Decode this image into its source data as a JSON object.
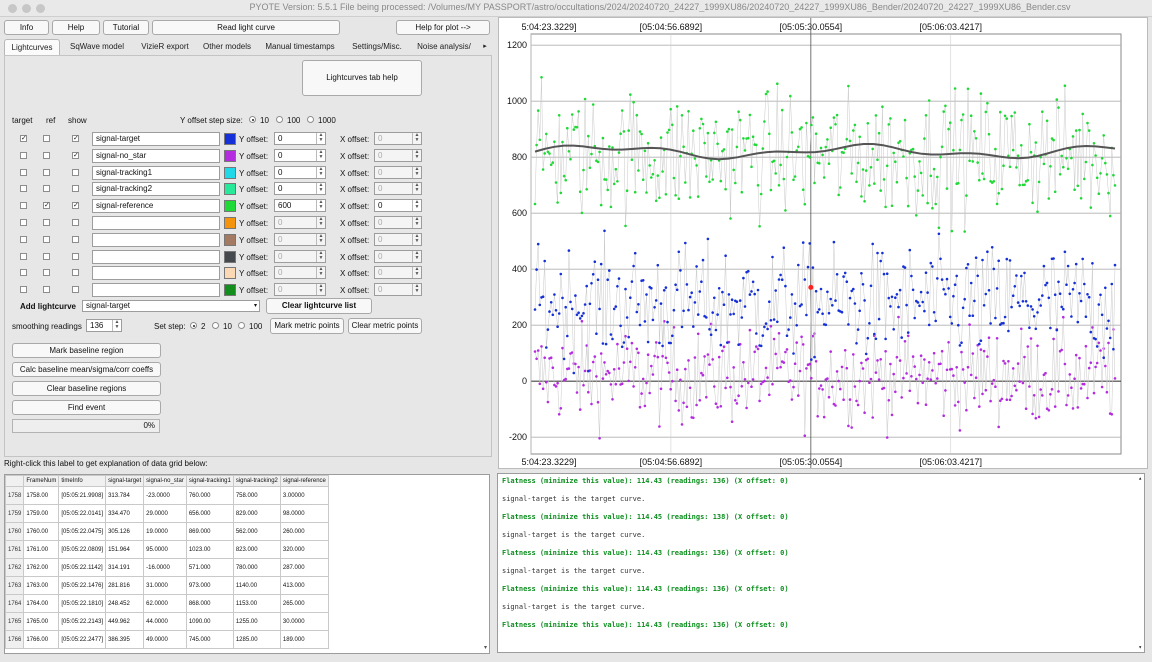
{
  "titlebar": {
    "text": "PYOTE Version: 5.5.1  File being processed: /Volumes/MY PASSPORT/astro/occultations/2024/20240720_24227_1999XU86/20240720_24227_1999XU86_Bender/20240720_24227_1999XU86_Bender.csv"
  },
  "top_buttons": {
    "info": "Info",
    "help": "Help",
    "tutorial": "Tutorial",
    "read": "Read light curve",
    "help_plot": "Help for plot -->"
  },
  "tabs": [
    "Lightcurves",
    "SqWave model",
    "VizieR export",
    "Other models",
    "Manual timestamps",
    "Settings/Misc.",
    "Noise analysis/"
  ],
  "lightcurves_help": "Lightcurves tab help",
  "headers": {
    "target": "target",
    "ref": "ref",
    "show": "show",
    "yoffset_step": "Y offset step size:",
    "step10": "10",
    "step100": "100",
    "step1000": "1000",
    "yoffset_label": "Y offset:",
    "xoffset_label": "X offset:"
  },
  "curves": [
    {
      "name": "signal-target",
      "color": "#1530d8",
      "target": true,
      "ref": false,
      "show": true,
      "yoffset": "0",
      "xoffset": "0",
      "enabled": true,
      "xoffset_enabled": false
    },
    {
      "name": "signal-no_star",
      "color": "#b42be0",
      "target": false,
      "ref": false,
      "show": true,
      "yoffset": "0",
      "xoffset": "0",
      "enabled": true,
      "xoffset_enabled": false
    },
    {
      "name": "signal-tracking1",
      "color": "#1fd8e8",
      "target": false,
      "ref": false,
      "show": false,
      "yoffset": "0",
      "xoffset": "0",
      "enabled": true,
      "xoffset_enabled": false
    },
    {
      "name": "signal-tracking2",
      "color": "#28e99a",
      "target": false,
      "ref": false,
      "show": false,
      "yoffset": "0",
      "xoffset": "0",
      "enabled": true,
      "xoffset_enabled": false
    },
    {
      "name": "signal-reference",
      "color": "#1fd936",
      "target": false,
      "ref": true,
      "show": true,
      "yoffset": "600",
      "xoffset": "0",
      "enabled": true,
      "xoffset_enabled": true
    },
    {
      "name": "",
      "color": "#f4930c",
      "target": false,
      "ref": false,
      "show": false,
      "yoffset": "0",
      "xoffset": "0",
      "enabled": false,
      "xoffset_enabled": false
    },
    {
      "name": "",
      "color": "#a47a63",
      "target": false,
      "ref": false,
      "show": false,
      "yoffset": "0",
      "xoffset": "0",
      "enabled": false,
      "xoffset_enabled": false
    },
    {
      "name": "",
      "color": "#45484d",
      "target": false,
      "ref": false,
      "show": false,
      "yoffset": "0",
      "xoffset": "0",
      "enabled": false,
      "xoffset_enabled": false
    },
    {
      "name": "",
      "color": "#fcd9b5",
      "target": false,
      "ref": false,
      "show": false,
      "yoffset": "0",
      "xoffset": "0",
      "enabled": false,
      "xoffset_enabled": false
    },
    {
      "name": "",
      "color": "#138d1c",
      "target": false,
      "ref": false,
      "show": false,
      "yoffset": "0",
      "xoffset": "0",
      "enabled": false,
      "xoffset_enabled": false
    }
  ],
  "add_lightcurve": {
    "label": "Add lightcurve",
    "selected": "signal-target",
    "clear": "Clear lightcurve list"
  },
  "smoothing": {
    "label": "smoothing readings",
    "value": "136",
    "setstep": "Set step:",
    "s2": "2",
    "s10": "10",
    "s100": "100",
    "mark_metric": "Mark metric points",
    "clear_metric": "Clear metric points"
  },
  "actions": {
    "mark_baseline": "Mark baseline region",
    "calc_baseline": "Calc baseline mean/sigma/corr coeffs",
    "clear_baseline": "Clear baseline regions",
    "find_event": "Find event",
    "progress": "0%"
  },
  "grid_hint": "Right-click this label to get explanation of data grid below:",
  "grid": {
    "columns": [
      "FrameNum",
      "timeInfo",
      "signal-target",
      "signal-no_star",
      "signal-tracking1",
      "signal-tracking2",
      "signal-reference"
    ],
    "rows": [
      [
        "1758",
        "1758.00",
        "[05:05:21.9908]",
        "313.784",
        "-23.0000",
        "760.000",
        "758.000",
        "3.00000"
      ],
      [
        "1759",
        "1759.00",
        "[05:05:22.0141]",
        "334.470",
        "29.0000",
        "656.000",
        "829.000",
        "98.0000"
      ],
      [
        "1760",
        "1760.00",
        "[05:05:22.0475]",
        "305.126",
        "19.0000",
        "869.000",
        "562.000",
        "260.000"
      ],
      [
        "1761",
        "1761.00",
        "[05:05:22.0809]",
        "151.964",
        "95.0000",
        "1023.00",
        "823.000",
        "320.000"
      ],
      [
        "1762",
        "1762.00",
        "[05:05:22.1142]",
        "314.191",
        "-16.0000",
        "571.000",
        "780.000",
        "287.000"
      ],
      [
        "1763",
        "1763.00",
        "[05:05:22.1476]",
        "281.816",
        "31.0000",
        "973.000",
        "1140.00",
        "413.000"
      ],
      [
        "1764",
        "1764.00",
        "[05:05:22.1810]",
        "248.452",
        "62.0000",
        "868.000",
        "1153.00",
        "265.000"
      ],
      [
        "1765",
        "1765.00",
        "[05:05:22.2143]",
        "449.962",
        "44.0000",
        "1090.00",
        "1255.00",
        "30.0000"
      ],
      [
        "1766",
        "1766.00",
        "[05:05:22.2477]",
        "386.395",
        "49.0000",
        "745.000",
        "1285.00",
        "189.000"
      ]
    ]
  },
  "log": [
    {
      "text": "Flatness (minimize this value): 114.43 (readings: 136) (X offset: 0)",
      "green": true
    },
    {
      "text": "signal-target is the target curve.",
      "green": false
    },
    {
      "text": "Flatness (minimize this value): 114.45 (readings: 138) (X offset: 0)",
      "green": true
    },
    {
      "text": "signal-target is the target curve.",
      "green": false
    },
    {
      "text": "Flatness (minimize this value): 114.43 (readings: 136) (X offset: 0)",
      "green": true
    },
    {
      "text": "signal-target is the target curve.",
      "green": false
    },
    {
      "text": "Flatness (minimize this value): 114.43 (readings: 136) (X offset: 0)",
      "green": true
    },
    {
      "text": "signal-target is the target curve.",
      "green": false
    },
    {
      "text": "Flatness (minimize this value): 114.43 (readings: 136) (X offset: 0)",
      "green": true
    }
  ],
  "chart_data": {
    "type": "scatter",
    "x_tick_labels": [
      "5:04:23.3229]",
      "[05:04:56.6892]",
      "[05:05:30.0554]",
      "[05:06:03.4217]"
    ],
    "yticks": [
      -200,
      0,
      200,
      400,
      600,
      800,
      1000,
      1200
    ],
    "ylim": [
      -260,
      1240
    ],
    "grid": true,
    "cursor_tick": "[05:05:30.0554]",
    "series": [
      {
        "key": "signal-reference",
        "color": "#1fd936",
        "mean": 810,
        "spread": 110
      },
      {
        "key": "signal-target",
        "color": "#1530d8",
        "mean": 280,
        "spread": 100
      },
      {
        "key": "signal-no_star",
        "color": "#b42be0",
        "mean": 20,
        "spread": 85
      }
    ],
    "smoothed_color": "#555555",
    "smoothed_mean": 820,
    "highlight_color": "#ff2020",
    "highlight_value": 335
  }
}
